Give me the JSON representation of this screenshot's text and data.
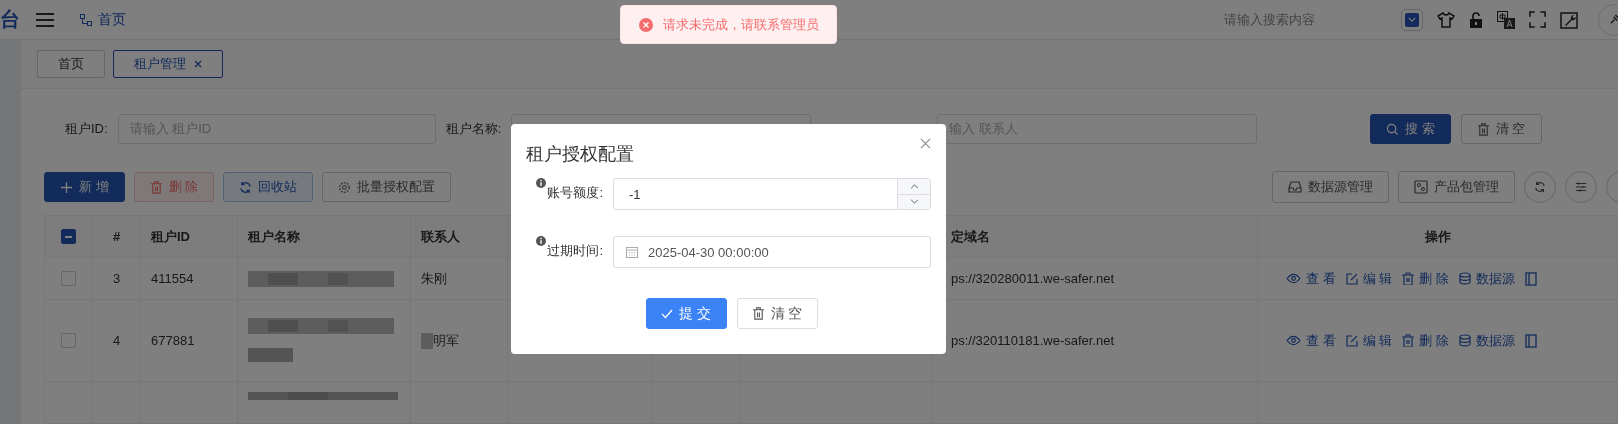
{
  "header": {
    "logo": "台",
    "breadcrumb": "首页",
    "search_placeholder": "请输入搜索内容"
  },
  "toast": {
    "kind": "error",
    "text": "请求未完成，请联系管理员"
  },
  "tabs": [
    {
      "label": "首页",
      "selected": false
    },
    {
      "label": "租户管理",
      "selected": true
    }
  ],
  "search_form": {
    "fields": [
      {
        "label": "租户ID:",
        "placeholder": "请输入 租户ID"
      },
      {
        "label": "租户名称:"
      },
      {
        "placeholder": "输入 联系人"
      }
    ],
    "buttons": [
      {
        "label": "搜 索",
        "kind": "primary"
      },
      {
        "label": "清 空",
        "kind": "default"
      }
    ]
  },
  "toolbar": {
    "left": [
      {
        "label": "新 增",
        "kind": "primary"
      },
      {
        "label": "删 除",
        "kind": "danger"
      },
      {
        "label": "回收站",
        "kind": "info"
      },
      {
        "label": "批量授权配置",
        "kind": "default"
      }
    ],
    "right": [
      {
        "label": "数据源管理",
        "kind": "datasource"
      },
      {
        "label": "产品包管理",
        "kind": "package"
      }
    ]
  },
  "table": {
    "header_checkbox": {
      "indeterminate": true
    },
    "columns": [
      "#",
      "租户ID",
      "租户名称",
      "联系人",
      "定域名",
      "操作"
    ],
    "rows": [
      {
        "kind": "full",
        "selected": false,
        "index": "3",
        "id": "411554",
        "contact": "朱刚",
        "domain": "ps://320280011.we-safer.net",
        "actions": [
          "查 看",
          "编 辑",
          "删 除",
          "数据源"
        ]
      },
      {
        "kind": "full",
        "selected": false,
        "index": "4",
        "id": "677881",
        "contact": "明军",
        "domain": "ps://320110181.we-safer.net",
        "actions": [
          "查 看",
          "编 辑",
          "删 除",
          "数据源"
        ]
      },
      {
        "kind": "partial"
      }
    ]
  },
  "dialog": {
    "title": "租户授权配置",
    "fields": [
      {
        "kind": "number",
        "label": "账号额度:",
        "value": "-1"
      },
      {
        "kind": "date",
        "label": "过期时间:",
        "value": "2025-04-30 00:00:00"
      }
    ],
    "buttons": [
      {
        "label": "提 交",
        "kind": "primary"
      },
      {
        "label": "清 空",
        "kind": "default"
      }
    ]
  }
}
